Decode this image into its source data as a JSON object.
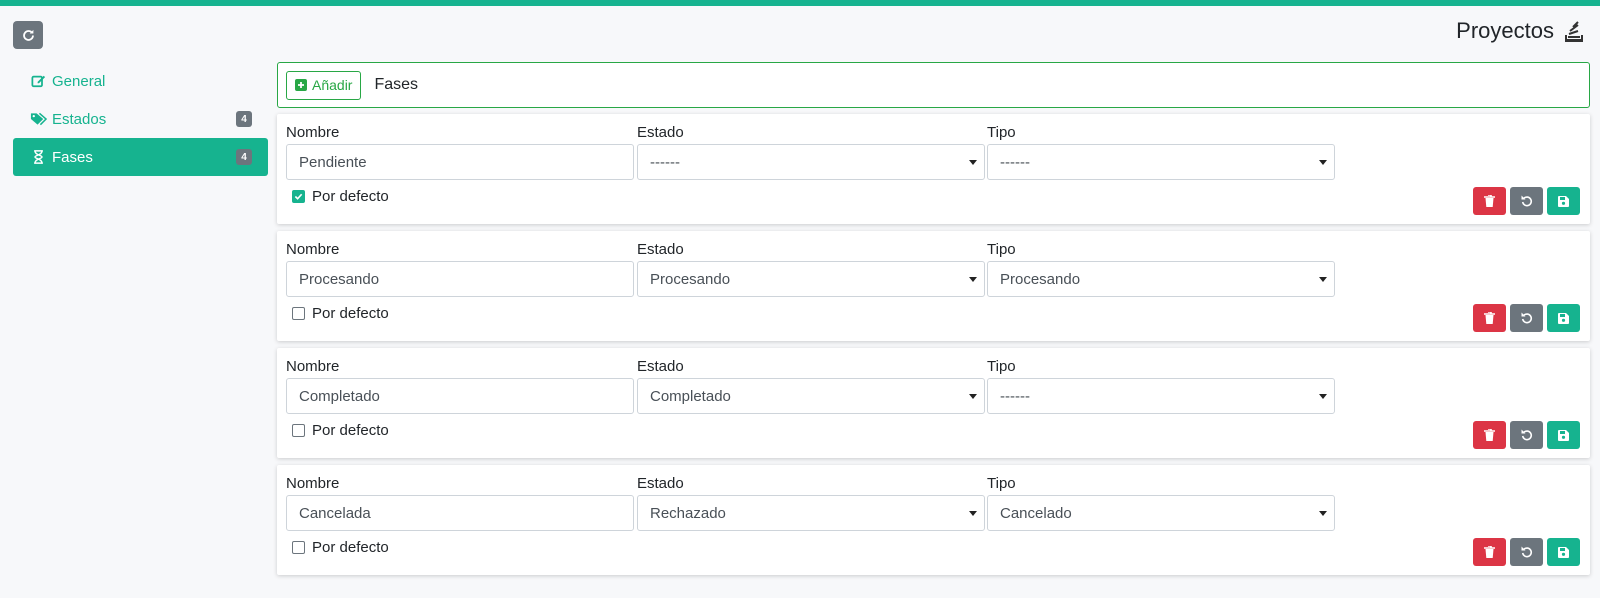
{
  "header": {
    "title": "Proyectos",
    "title_icon": "stack-icon",
    "refresh_icon": "refresh-icon"
  },
  "colors": {
    "accent": "#16b38f",
    "danger": "#dc3545",
    "secondary": "#6c757d",
    "success": "#28a745"
  },
  "sidebar": {
    "items": [
      {
        "label": "General",
        "icon": "edit-icon",
        "badge": ""
      },
      {
        "label": "Estados",
        "icon": "tags-icon",
        "badge": "4"
      },
      {
        "label": "Fases",
        "icon": "hourglass-icon",
        "badge": "4",
        "active": true
      }
    ]
  },
  "toolbar": {
    "add_label": "Añadir",
    "section_label": "Fases"
  },
  "labels": {
    "name": "Nombre",
    "state": "Estado",
    "type": "Tipo",
    "default": "Por defecto"
  },
  "phases": [
    {
      "name": "Pendiente",
      "state": "------",
      "type": "------",
      "default": true
    },
    {
      "name": "Procesando",
      "state": "Procesando",
      "type": "Procesando",
      "default": false
    },
    {
      "name": "Completado",
      "state": "Completado",
      "type": "------",
      "default": false
    },
    {
      "name": "Cancelada",
      "state": "Rechazado",
      "type": "Cancelado",
      "default": false
    }
  ]
}
